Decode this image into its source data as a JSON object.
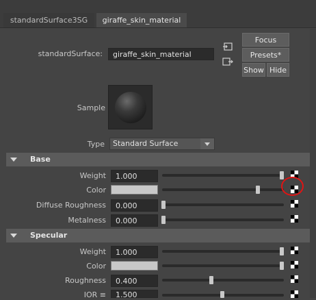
{
  "tabs": [
    {
      "label": "standardSurface3SG",
      "active": false
    },
    {
      "label": "giraffe_skin_material",
      "active": true
    }
  ],
  "header": {
    "node_type_label": "standardSurface:",
    "node_name_value": "giraffe_skin_material",
    "focus_label": "Focus",
    "presets_label": "Presets*",
    "show_label": "Show",
    "hide_label": "Hide"
  },
  "sample": {
    "label": "Sample"
  },
  "type": {
    "label": "Type",
    "value": "Standard Surface"
  },
  "sections": {
    "base": {
      "title": "Base",
      "weight_label": "Weight",
      "weight_value": "1.000",
      "weight_level": 1.0,
      "color_label": "Color",
      "color_swatch": "#c8c8c8",
      "color_level": 0.8,
      "diffuse_roughness_label": "Diffuse Roughness",
      "diffuse_roughness_value": "0.000",
      "diffuse_roughness_level": 0.0,
      "metalness_label": "Metalness",
      "metalness_value": "0.000",
      "metalness_level": 0.0
    },
    "specular": {
      "title": "Specular",
      "weight_label": "Weight",
      "weight_value": "1.000",
      "weight_level": 1.0,
      "color_label": "Color",
      "color_swatch": "#c8c8c8",
      "color_level": 1.0,
      "roughness_label": "Roughness",
      "roughness_value": "0.400",
      "roughness_level": 0.4,
      "ior_label": "IOR ≡",
      "ior_value": "1.500",
      "ior_level": 0.5
    }
  },
  "colors": {
    "background": "#444444",
    "highlight": "#e01414"
  }
}
